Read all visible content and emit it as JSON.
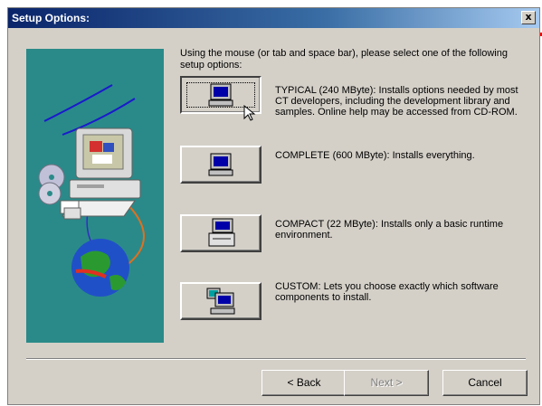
{
  "window": {
    "title": "Setup Options:",
    "close_glyph": "x"
  },
  "intro_text": "Using the mouse (or tab and space bar), please select one of the following setup options:",
  "options": [
    {
      "icon": "computer-icon",
      "text": "TYPICAL (240 MByte): Installs options needed by most CT developers, including the development library and samples.  Online help may be accessed from CD-ROM."
    },
    {
      "icon": "computer-icon",
      "text": "COMPLETE (600 MByte): Installs everything."
    },
    {
      "icon": "computer-printer-icon",
      "text": "COMPACT (22 MByte): Installs only a basic runtime environment."
    },
    {
      "icon": "computer-components-icon",
      "text": "CUSTOM: Lets you choose exactly which software components to install."
    }
  ],
  "buttons": {
    "back": "< Back",
    "next": "Next >",
    "cancel": "Cancel"
  },
  "colors": {
    "annotation": "#ee0000",
    "art_background": "#2a8a89"
  }
}
